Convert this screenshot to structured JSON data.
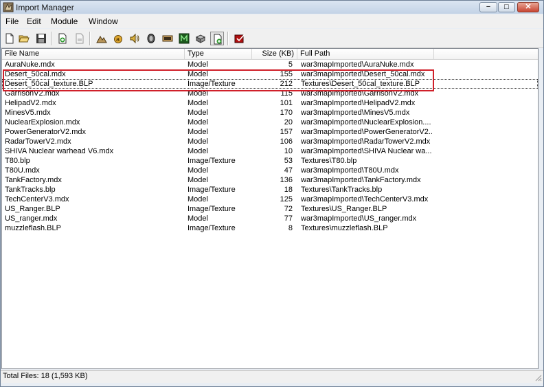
{
  "window": {
    "title": "Import Manager",
    "controls": {
      "minimize": "−",
      "maximize": "□",
      "close": "✕"
    }
  },
  "menu": {
    "items": [
      "File",
      "Edit",
      "Module",
      "Window"
    ]
  },
  "toolbar": {
    "buttons": [
      {
        "icon": "new-document-icon"
      },
      {
        "icon": "open-folder-icon"
      },
      {
        "icon": "save-disk-icon"
      },
      {
        "icon": "import-file-icon"
      },
      {
        "icon": "export-file-icon"
      },
      {
        "icon": "terrain-editor-icon"
      },
      {
        "icon": "trigger-editor-icon"
      },
      {
        "icon": "sound-editor-icon"
      },
      {
        "icon": "ai-editor-icon"
      },
      {
        "icon": "campaign-editor-icon"
      },
      {
        "icon": "object-editor-icon"
      },
      {
        "icon": "import-manager-icon"
      },
      {
        "icon": "test-map-icon"
      }
    ]
  },
  "table": {
    "columns": {
      "name": "File Name",
      "type": "Type",
      "size": "Size (KB)",
      "path": "Full Path"
    },
    "rows": [
      {
        "name": "AuraNuke.mdx",
        "type": "Model",
        "size": "5",
        "path": "war3mapImported\\AuraNuke.mdx"
      },
      {
        "name": "Desert_50cal.mdx",
        "type": "Model",
        "size": "155",
        "path": "war3mapImported\\Desert_50cal.mdx"
      },
      {
        "name": "Desert_50cal_texture.BLP",
        "type": "Image/Texture",
        "size": "212",
        "path": "Textures\\Desert_50cal_texture.BLP"
      },
      {
        "name": "GarrisonV2.mdx",
        "type": "Model",
        "size": "115",
        "path": "war3mapImported\\GarrisonV2.mdx"
      },
      {
        "name": "HelipadV2.mdx",
        "type": "Model",
        "size": "101",
        "path": "war3mapImported\\HelipadV2.mdx"
      },
      {
        "name": "MinesV5.mdx",
        "type": "Model",
        "size": "170",
        "path": "war3mapImported\\MinesV5.mdx"
      },
      {
        "name": "NuclearExplosion.mdx",
        "type": "Model",
        "size": "20",
        "path": "war3mapImported\\NuclearExplosion...."
      },
      {
        "name": "PowerGeneratorV2.mdx",
        "type": "Model",
        "size": "157",
        "path": "war3mapImported\\PowerGeneratorV2..."
      },
      {
        "name": "RadarTowerV2.mdx",
        "type": "Model",
        "size": "106",
        "path": "war3mapImported\\RadarTowerV2.mdx"
      },
      {
        "name": "SHIVA Nuclear warhead V6.mdx",
        "type": "Model",
        "size": "10",
        "path": "war3mapImported\\SHIVA Nuclear wa..."
      },
      {
        "name": "T80.blp",
        "type": "Image/Texture",
        "size": "53",
        "path": "Textures\\T80.blp"
      },
      {
        "name": "T80U.mdx",
        "type": "Model",
        "size": "47",
        "path": "war3mapImported\\T80U.mdx"
      },
      {
        "name": "TankFactory.mdx",
        "type": "Model",
        "size": "136",
        "path": "war3mapImported\\TankFactory.mdx"
      },
      {
        "name": "TankTracks.blp",
        "type": "Image/Texture",
        "size": "18",
        "path": "Textures\\TankTracks.blp"
      },
      {
        "name": "TechCenterV3.mdx",
        "type": "Model",
        "size": "125",
        "path": "war3mapImported\\TechCenterV3.mdx"
      },
      {
        "name": "US_Ranger.BLP",
        "type": "Image/Texture",
        "size": "72",
        "path": "Textures\\US_Ranger.BLP"
      },
      {
        "name": "US_ranger.mdx",
        "type": "Model",
        "size": "77",
        "path": "war3mapImported\\US_ranger.mdx"
      },
      {
        "name": "muzzleflash.BLP",
        "type": "Image/Texture",
        "size": "8",
        "path": "Textures\\muzzleflash.BLP"
      }
    ]
  },
  "status": {
    "text": "Total Files: 18 (1,593 KB)"
  },
  "colors": {
    "highlight": "#d0202a"
  }
}
